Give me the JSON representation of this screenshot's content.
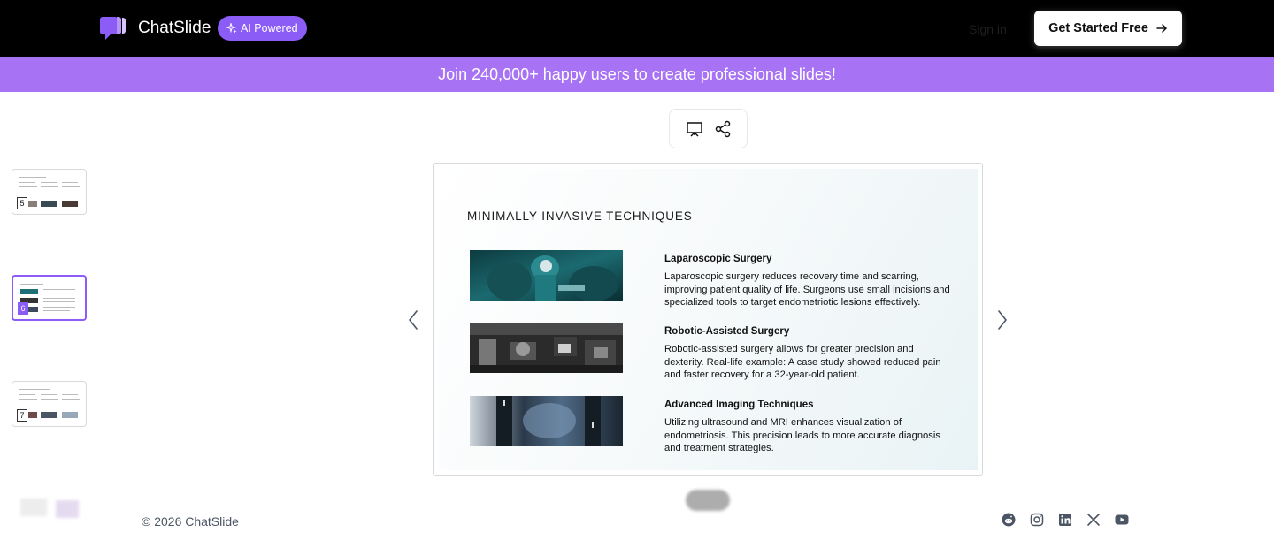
{
  "header": {
    "brand": "ChatSlide",
    "badge": "AI Powered",
    "signin": "Sign in",
    "cta": "Get Started Free"
  },
  "banner": {
    "text": "Join 240,000+ happy users to create professional slides!"
  },
  "thumbnails": [
    {
      "number": "5",
      "active": false
    },
    {
      "number": "6",
      "active": true
    },
    {
      "number": "7",
      "active": false
    }
  ],
  "slide": {
    "title": "MINIMALLY INVASIVE TECHNIQUES",
    "sections": [
      {
        "heading": "Laparoscopic Surgery",
        "body": "Laparoscopic surgery reduces recovery time and scarring, improving patient quality of life. Surgeons use small incisions and specialized tools to target endometriotic lesions effectively."
      },
      {
        "heading": "Robotic-Assisted Surgery",
        "body": "Robotic-assisted surgery allows for greater precision and dexterity. Real-life example: A case study showed reduced pain and faster recovery for a 32-year-old patient."
      },
      {
        "heading": "Advanced Imaging Techniques",
        "body": "Utilizing ultrasound and MRI enhances visualization of endometriosis. This precision leads to more accurate diagnosis and treatment strategies."
      }
    ]
  },
  "footer": {
    "copyright": "© 2026 ChatSlide",
    "social_icons": [
      "reddit-icon",
      "instagram-icon",
      "linkedin-icon",
      "x-icon",
      "youtube-icon"
    ]
  },
  "colors": {
    "accent": "#8b5cf6",
    "banner": "#a872f4",
    "header_bg": "#000000"
  }
}
